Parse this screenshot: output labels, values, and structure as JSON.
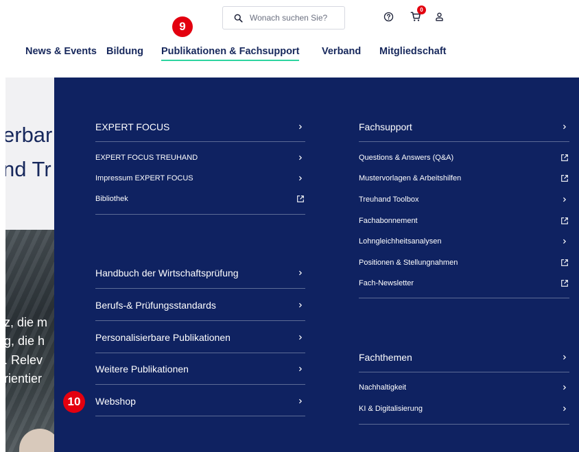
{
  "header": {
    "search": {
      "placeholder": "Wonach suchen Sie?"
    },
    "cart_count": "0",
    "step_badge_top": "9",
    "step_badge_bottom": "10"
  },
  "nav": {
    "items": [
      {
        "label": "News & Events"
      },
      {
        "label": "Bildung"
      },
      {
        "label": "Publikationen & Fachsupport",
        "active": true
      },
      {
        "label": "Verband"
      },
      {
        "label": "Mitgliedschaft"
      }
    ]
  },
  "hero": {
    "title_line1": "erbar",
    "title_line2": "nd Tr",
    "text_lines": [
      "z, die m",
      "g, die h",
      ". Relev",
      "rientier"
    ]
  },
  "menu": {
    "expert_focus": {
      "title": "EXPERT FOCUS",
      "items": [
        {
          "label": "EXPERT FOCUS TREUHAND",
          "icon": "chevron-right-icon"
        },
        {
          "label": "Impressum EXPERT FOCUS",
          "icon": "chevron-right-icon"
        },
        {
          "label": "Bibliothek",
          "icon": "external-link-icon"
        }
      ]
    },
    "publications": [
      {
        "label": "Handbuch der Wirtschaftsprüfung"
      },
      {
        "label": "Berufs-& Prüfungsstandards"
      },
      {
        "label": "Personalisierbare Publikationen"
      },
      {
        "label": "Weitere Publikationen"
      },
      {
        "label": "Webshop"
      }
    ],
    "fachsupport": {
      "title": "Fachsupport",
      "items": [
        {
          "label": "Questions & Answers (Q&A)",
          "icon": "external-link-icon"
        },
        {
          "label": "Mustervorlagen & Arbeitshilfen",
          "icon": "external-link-icon"
        },
        {
          "label": "Treuhand Toolbox",
          "icon": "chevron-right-icon"
        },
        {
          "label": "Fachabonnement",
          "icon": "external-link-icon"
        },
        {
          "label": "Lohngleichheitsanalysen",
          "icon": "chevron-right-icon"
        },
        {
          "label": "Positionen & Stellungnahmen",
          "icon": "external-link-icon"
        },
        {
          "label": "Fach-Newsletter",
          "icon": "external-link-icon"
        }
      ]
    },
    "fachthemen": {
      "title": "Fachthemen",
      "items": [
        {
          "label": "Nachhaltigkeit",
          "icon": "chevron-right-icon"
        },
        {
          "label": "KI & Digitalisierung",
          "icon": "chevron-right-icon"
        }
      ]
    }
  },
  "colors": {
    "panel": "#0f2261",
    "nav_text": "#17285c",
    "active_underline": "#2dd4a0",
    "badge": "#e3000f"
  }
}
